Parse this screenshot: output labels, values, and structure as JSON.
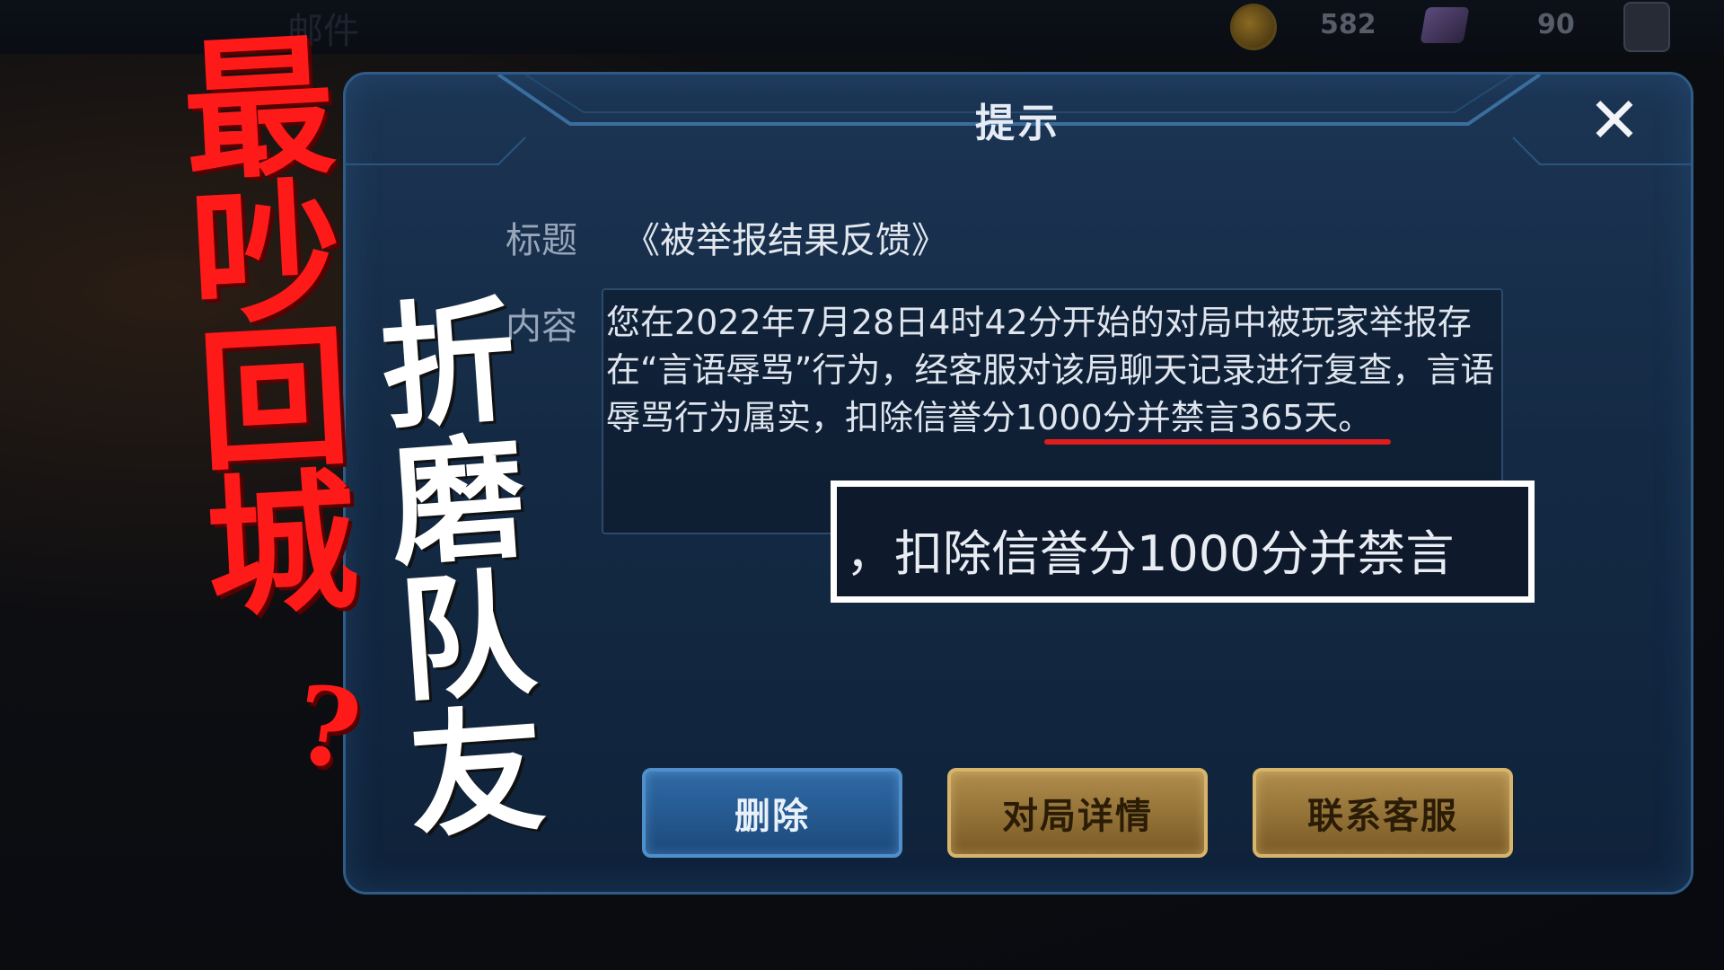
{
  "topbar": {
    "title": "邮件",
    "coins": "582",
    "gems": "90"
  },
  "dialog": {
    "title": "提示",
    "close_label": "✕",
    "subject_label": "标题",
    "subject_value": "《被举报结果反馈》",
    "content_label": "内容",
    "content_text": "您在2022年7月28日4时42分开始的对局中被玩家举报存在“言语辱骂”行为，经客服对该局聊天记录进行复查，言语辱骂行为属实，扣除信誉分1000分并禁言365天。",
    "highlight_text": "，扣除信誉分1000分并禁言",
    "buttons": {
      "delete": "删除",
      "match_details": "对局详情",
      "contact_service": "联系客服"
    }
  },
  "overlay": {
    "red_text": "最吵回城",
    "question_mark": "?",
    "white_text": "折磨队友"
  },
  "colors": {
    "accent_red": "#e01c1c",
    "dialog_bg": "#142a44",
    "gold_button": "#b08d4c",
    "blue_button": "#2f6aa6"
  }
}
